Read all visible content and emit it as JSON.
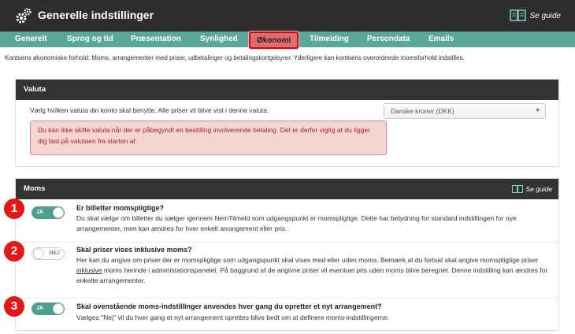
{
  "header": {
    "title": "Generelle indstillinger",
    "guide_label": "Se guide"
  },
  "tabs": [
    {
      "label": "Generelt"
    },
    {
      "label": "Sprog og tid"
    },
    {
      "label": "Præsentation"
    },
    {
      "label": "Synlighed"
    },
    {
      "label": "Økonomi",
      "active": true
    },
    {
      "label": "Tilmelding"
    },
    {
      "label": "Persondata"
    },
    {
      "label": "Emails"
    }
  ],
  "intro": "Kontoens økonomiske forhold: Moms, arrangementer med priser, udbetalinger og betalingskortgebyrer. Yderligere kan kontoens overordnede momsforhold indstilles.",
  "valuta": {
    "heading": "Valuta",
    "text": "Vælg hvilken valuta din konto skal benytte. Alle priser vil blive vist i denne valuta.",
    "warning": "Du kan ikke skifte valuta når der er påbegyndt en bestilling involverende betaling. Det er derfor vigtig at du ligger dig fast på valutaen fra starten af.",
    "selected": "Danske kroner (DKK)"
  },
  "moms": {
    "heading": "Moms",
    "guide_label": "Se guide",
    "rows": [
      {
        "number": "1",
        "toggle": "JA",
        "question": "Er billetter momspligtige?",
        "description": "Du skal vælge om billetter du sælger igennem NemTilmeld som udgangspunkt er momspligtige. Dette har betydning for standard indstillingen for nye arrangementer, men kan ændres for hver enkelt arrangement eller pris."
      },
      {
        "number": "2",
        "toggle": "NEJ",
        "question": "Skal priser vises inklusive moms?",
        "description_pre": "Her kan du angive om priser der er momspligtige som udgangspunkt skal vises med eller uden moms. Bemærk at du fortsat skal angive momspligtige priser ",
        "description_u": "inklusive",
        "description_post": " moms herinde i administationspanelet. På baggrund af de angivne priser vil eventuel pris uden moms blive beregnet. Denne indstilling kan ændres for enkelte arrangementer."
      },
      {
        "number": "3",
        "toggle": "JA",
        "question": "Skal ovenstående moms-indstillinger anvendes hver gang du opretter et nyt arrangement?",
        "description": "Vælges \"Nej\" vil du hver gang et nyt arrangement oprettes blive bedt om at definere moms-indstillingerne."
      }
    ]
  },
  "colors": {
    "header_bg": "#2e2e2e",
    "tab_bg": "#5aa89a",
    "active_tab": "#e36a6f",
    "toggle_on": "#4f9e8f",
    "marker_red": "#e01818"
  }
}
